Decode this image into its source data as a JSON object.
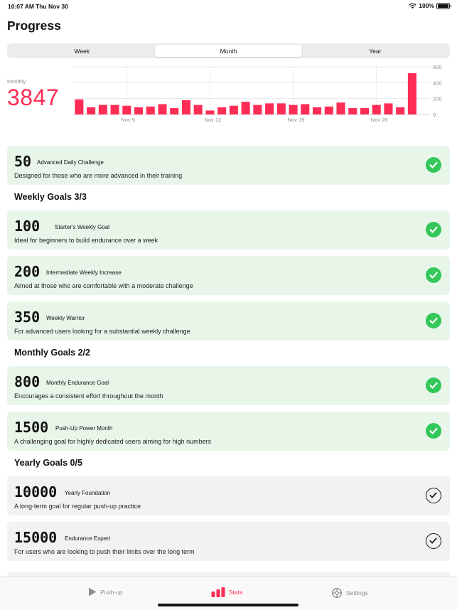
{
  "status_bar": {
    "time": "10:07 AM",
    "date": "Thu Nov 30",
    "battery": "100%"
  },
  "page_title": "Progress",
  "segments": [
    {
      "label": "Week",
      "active": false
    },
    {
      "label": "Month",
      "active": true
    },
    {
      "label": "Year",
      "active": false
    }
  ],
  "summary": {
    "label": "Monthly",
    "value": "3847"
  },
  "chart_data": {
    "type": "bar",
    "color": "#ff2d55",
    "x": [
      "Nov 1",
      "Nov 2",
      "Nov 3",
      "Nov 4",
      "Nov 5",
      "Nov 6",
      "Nov 7",
      "Nov 8",
      "Nov 9",
      "Nov 10",
      "Nov 11",
      "Nov 12",
      "Nov 13",
      "Nov 14",
      "Nov 15",
      "Nov 16",
      "Nov 17",
      "Nov 18",
      "Nov 19",
      "Nov 20",
      "Nov 21",
      "Nov 22",
      "Nov 23",
      "Nov 24",
      "Nov 25",
      "Nov 26",
      "Nov 27",
      "Nov 28",
      "Nov 29",
      "Nov 30"
    ],
    "values": [
      190,
      90,
      120,
      120,
      110,
      90,
      100,
      130,
      80,
      180,
      120,
      50,
      90,
      110,
      160,
      120,
      140,
      140,
      120,
      130,
      90,
      100,
      150,
      80,
      80,
      120,
      140,
      90,
      520,
      0
    ],
    "x_tick_labels": [
      {
        "label": "Nov 5",
        "index": 4
      },
      {
        "label": "Nov 12",
        "index": 11
      },
      {
        "label": "Nov 19",
        "index": 18
      },
      {
        "label": "Nov 26",
        "index": 25
      }
    ],
    "y_ticks": [
      0,
      200,
      400,
      600
    ],
    "ylim": [
      0,
      600
    ],
    "grid": true
  },
  "goals": {
    "daily": [
      {
        "number": "50",
        "title": "Advanced Daily Challenge",
        "description": "Designed for those who are more advanced in their training",
        "completed": true
      }
    ],
    "weekly_heading": "Weekly Goals 3/3",
    "weekly": [
      {
        "number": "100",
        "title": "Starter's Weekly Goal",
        "description": "Ideal for beginners to build endurance over a week",
        "completed": true
      },
      {
        "number": "200",
        "title": "Intermediate Weekly Increase",
        "description": "Aimed at those who are comfortable with a moderate challenge",
        "completed": true
      },
      {
        "number": "350",
        "title": "Weekly Warrior",
        "description": "For advanced users looking for a substantial weekly challenge",
        "completed": true
      }
    ],
    "monthly_heading": "Monthly Goals 2/2",
    "monthly": [
      {
        "number": "800",
        "title": "Monthly Endurance Goal",
        "description": "Encourages a consistent effort throughout the month",
        "completed": true
      },
      {
        "number": "1500",
        "title": "Push-Up Power Month",
        "description": "A challenging goal for highly dedicated users aiming for high numbers",
        "completed": true
      }
    ],
    "yearly_heading": "Yearly Goals 0/5",
    "yearly": [
      {
        "number": "10000",
        "title": "Yearly Foundation",
        "description": "A long-term goal for regular push-up practice",
        "completed": false
      },
      {
        "number": "15000",
        "title": "Endurance Expert",
        "description": "For users who are looking to push their limits over the long term",
        "completed": false
      }
    ]
  },
  "tabbar": [
    {
      "label": "Push-up",
      "icon": "play-icon",
      "active": false
    },
    {
      "label": "Stats",
      "icon": "bar-chart-icon",
      "active": true
    },
    {
      "label": "Settings",
      "icon": "gear-icon",
      "active": false
    }
  ],
  "colors": {
    "accent": "#ff2d55",
    "success": "#34c759",
    "done_card": "#e8f6ea",
    "todo_card": "#f2f2f4"
  }
}
